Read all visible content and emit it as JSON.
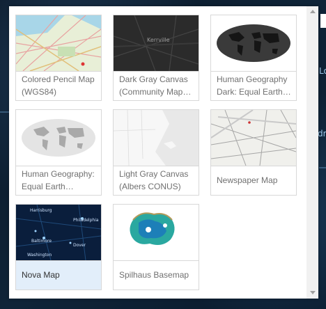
{
  "basemaps": [
    {
      "label": "Colored Pencil Map (WGS84)",
      "thumb": "colored-pencil"
    },
    {
      "label": "Dark Gray Canvas (Community Map…",
      "thumb": "dark-gray",
      "thumb_text": "Kerrville"
    },
    {
      "label": "Human Geography Dark: Equal Earth…",
      "thumb": "human-geo-dark"
    },
    {
      "label": "Human Geography: Equal Earth…",
      "thumb": "human-geo"
    },
    {
      "label": "Light Gray Canvas (Albers CONUS)",
      "thumb": "light-gray"
    },
    {
      "label": "Newspaper Map",
      "thumb": "newspaper"
    },
    {
      "label": "Nova Map",
      "thumb": "nova",
      "selected": true,
      "thumb_cities": [
        "Harrisburg",
        "Philadelphia",
        "Baltimore",
        "Washington",
        "Dover"
      ]
    },
    {
      "label": "Spilhaus Basemap",
      "thumb": "spilhaus"
    }
  ],
  "background_labels": [
    "Lo",
    "dm"
  ]
}
